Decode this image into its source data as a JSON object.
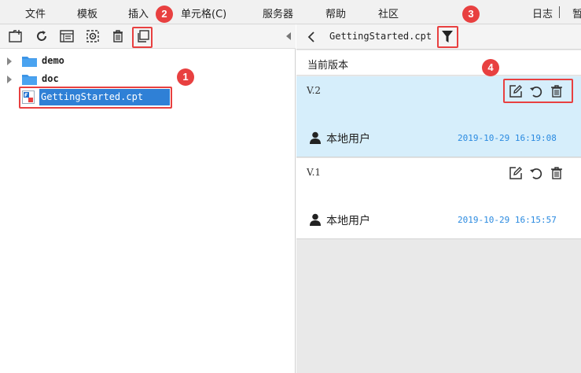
{
  "menubar": {
    "items": [
      "文件",
      "模板",
      "插入",
      "单元格(C)",
      "服务器",
      "帮助",
      "社区"
    ],
    "right_item": "日志",
    "right_item_cut": "暂"
  },
  "file_tree": {
    "folders": [
      {
        "name": "demo"
      },
      {
        "name": "doc"
      }
    ],
    "selected_file": "GettingStarted.cpt"
  },
  "version_panel": {
    "file_title": "GettingStarted.cpt",
    "section_title": "当前版本",
    "versions": [
      {
        "label": "V.2",
        "user": "本地用户",
        "time": "2019-10-29  16:19:08",
        "active": true
      },
      {
        "label": "V.1",
        "user": "本地用户",
        "time": "2019-10-29  16:15:57",
        "active": false
      }
    ]
  },
  "callouts": [
    "1",
    "2",
    "3",
    "4"
  ],
  "colors": {
    "accent": "#2f80d6",
    "callout_red": "#e84040",
    "active_card": "#d6eefb",
    "timestamp_blue": "#2a8ae0"
  },
  "icons": {
    "left_toolbar": [
      "new-folder-icon",
      "refresh-icon",
      "file-info-icon",
      "settings-gear-icon",
      "delete-icon",
      "copy-icon"
    ],
    "version_actions": [
      "edit-icon",
      "restore-icon",
      "delete-icon"
    ]
  }
}
